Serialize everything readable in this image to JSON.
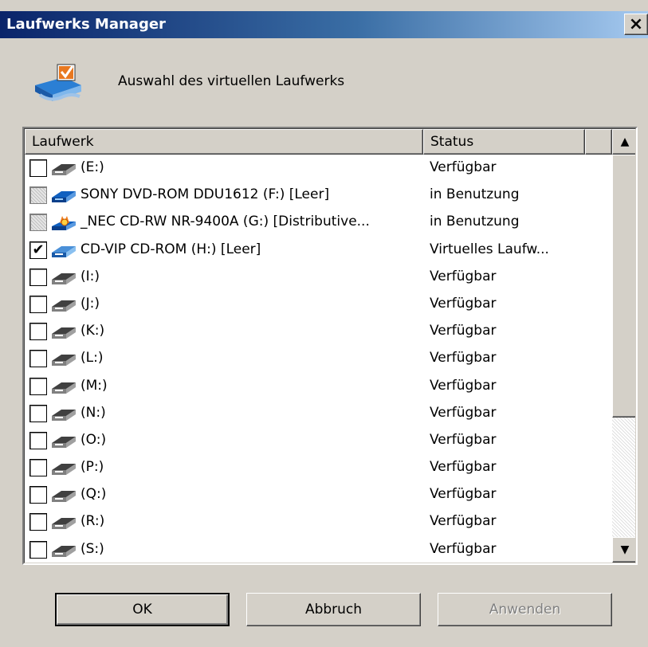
{
  "window": {
    "title": "Laufwerks Manager",
    "close_label": "×"
  },
  "header": {
    "text": "Auswahl des virtuellen Laufwerks",
    "icon": "drive-manager-icon"
  },
  "list": {
    "columns": [
      "Laufwerk",
      "Status"
    ],
    "rows": [
      {
        "label": "(E:)",
        "status": "Verfügbar",
        "checked": false,
        "disabled": false,
        "icon": "drive-icon"
      },
      {
        "label": "SONY DVD-ROM DDU1612 (F:) [Leer]",
        "status": "in Benutzung",
        "checked": false,
        "disabled": true,
        "icon": "dvd-drive-icon"
      },
      {
        "label": "_NEC CD-RW NR-9400A (G:) [Distributive...",
        "status": "in Benutzung",
        "checked": false,
        "disabled": true,
        "icon": "cd-burner-icon"
      },
      {
        "label": "CD-VIP CD-ROM (H:) [Leer]",
        "status": "Virtuelles Laufw...",
        "checked": true,
        "disabled": false,
        "icon": "virtual-drive-icon"
      },
      {
        "label": "(I:)",
        "status": "Verfügbar",
        "checked": false,
        "disabled": false,
        "icon": "drive-icon"
      },
      {
        "label": "(J:)",
        "status": "Verfügbar",
        "checked": false,
        "disabled": false,
        "icon": "drive-icon"
      },
      {
        "label": "(K:)",
        "status": "Verfügbar",
        "checked": false,
        "disabled": false,
        "icon": "drive-icon"
      },
      {
        "label": "(L:)",
        "status": "Verfügbar",
        "checked": false,
        "disabled": false,
        "icon": "drive-icon"
      },
      {
        "label": "(M:)",
        "status": "Verfügbar",
        "checked": false,
        "disabled": false,
        "icon": "drive-icon"
      },
      {
        "label": "(N:)",
        "status": "Verfügbar",
        "checked": false,
        "disabled": false,
        "icon": "drive-icon"
      },
      {
        "label": "(O:)",
        "status": "Verfügbar",
        "checked": false,
        "disabled": false,
        "icon": "drive-icon"
      },
      {
        "label": "(P:)",
        "status": "Verfügbar",
        "checked": false,
        "disabled": false,
        "icon": "drive-icon"
      },
      {
        "label": "(Q:)",
        "status": "Verfügbar",
        "checked": false,
        "disabled": false,
        "icon": "drive-icon"
      },
      {
        "label": "(R:)",
        "status": "Verfügbar",
        "checked": false,
        "disabled": false,
        "icon": "drive-icon"
      },
      {
        "label": "(S:)",
        "status": "Verfügbar",
        "checked": false,
        "disabled": false,
        "icon": "drive-icon"
      }
    ]
  },
  "buttons": {
    "ok": "OK",
    "cancel": "Abbruch",
    "apply": "Anwenden"
  },
  "colors": {
    "titlebar_start": "#0a246a",
    "titlebar_end": "#a6caf0",
    "dialog_bg": "#d4d0c8"
  }
}
